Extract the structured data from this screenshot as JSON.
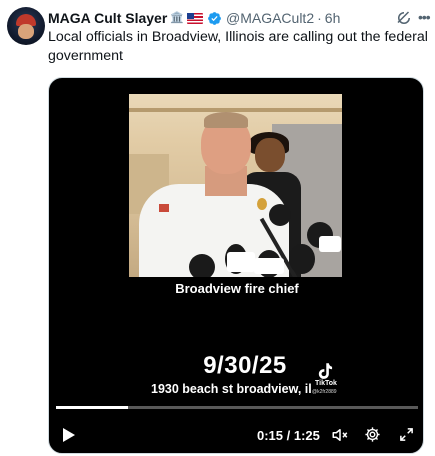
{
  "author": {
    "display_name": "MAGA Cult Slayer",
    "emoji_1": "🏛️",
    "emoji_2": "US flag",
    "handle": "@MAGACult2",
    "separator": "·",
    "time": "6h",
    "avatar_icon": "avatar-photo"
  },
  "tweet": {
    "text": "Local officials in Broadview, Illinois are calling out the federal government"
  },
  "video": {
    "caption": "Broadview fire chief",
    "date_overlay": "9/30/25",
    "address_overlay": "1930 beach st broadview, il",
    "watermark_label": "TikTok",
    "watermark_handle": "@k2fr2889",
    "progress": 0.2,
    "time_readout": "0:15 / 1:25",
    "controls": {
      "play_icon": "play-icon",
      "mute_icon": "mute-icon",
      "settings_icon": "gear-icon",
      "fullscreen_icon": "fullscreen-icon"
    }
  },
  "colors": {
    "text_primary": "#0f1419",
    "text_secondary": "#536471",
    "verified_blue": "#1d9bf0",
    "media_bg": "#000000"
  }
}
